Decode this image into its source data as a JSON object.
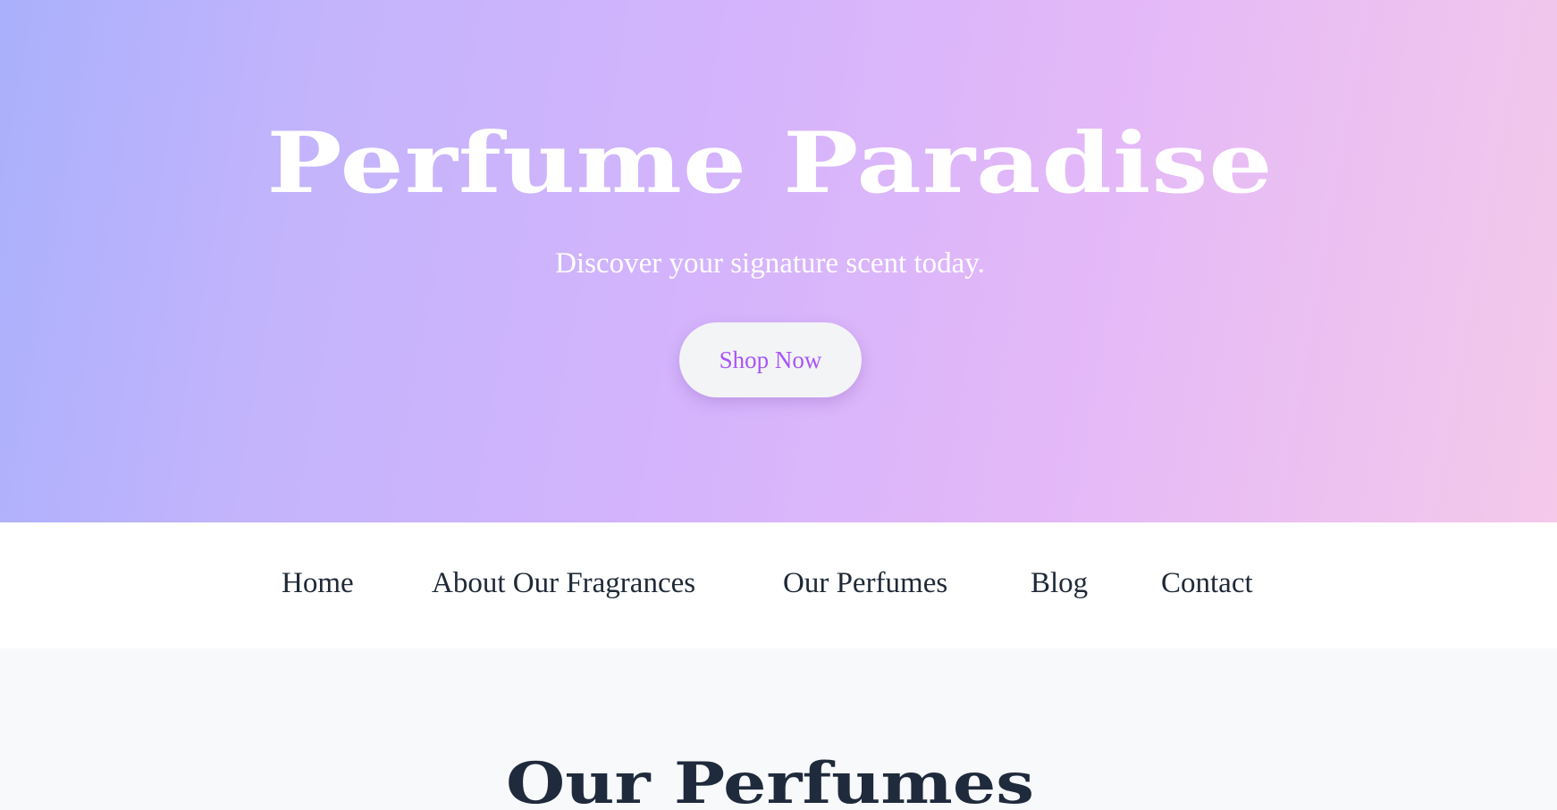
{
  "hero": {
    "title": "Perfume Paradise",
    "subtitle": "Discover your signature scent today.",
    "button_label": "Shop Now"
  },
  "nav": {
    "items": [
      {
        "label": "Home"
      },
      {
        "label": "About Our Fragrances"
      },
      {
        "label": "Our Perfumes"
      },
      {
        "label": "Blog"
      },
      {
        "label": "Contact"
      }
    ]
  },
  "products_section": {
    "title": "Our Perfumes"
  },
  "colors": {
    "hero_gradient_start": "#aab0fb",
    "hero_gradient_mid": "#d4b4fc",
    "hero_gradient_end": "#f4c9ea",
    "button_text": "#a855f7",
    "nav_text": "#1f2937",
    "section_title": "#1f2a3c"
  }
}
